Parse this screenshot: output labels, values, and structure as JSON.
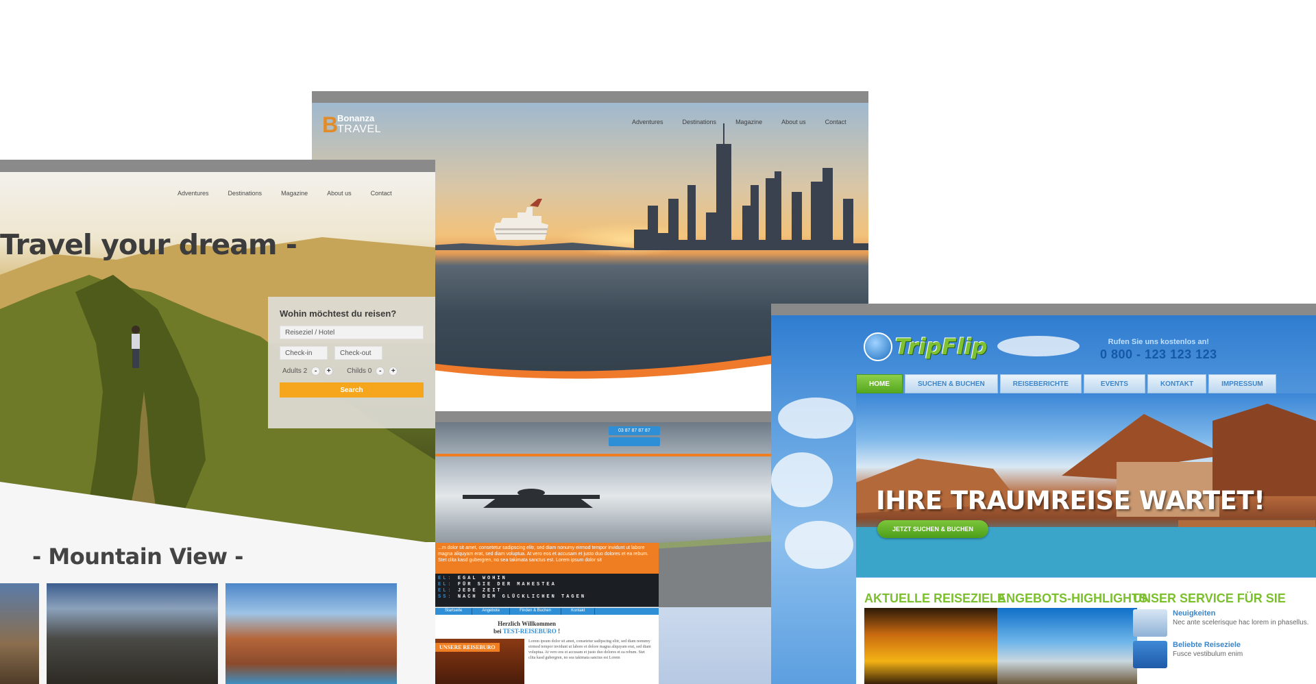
{
  "bonanza": {
    "logo_line1": "Bonanza",
    "logo_line2": "TRAVEL",
    "nav": [
      "Adventures",
      "Destinations",
      "Magazine",
      "About us",
      "Contact"
    ]
  },
  "travel": {
    "nav": [
      "Adventures",
      "Destinations",
      "Magazine",
      "About us",
      "Contact"
    ],
    "title": "Travel your dream -",
    "panel": {
      "heading": "Wohin möchtest du reisen?",
      "destination_placeholder": "Reiseziel / Hotel",
      "checkin": "Check-in",
      "checkout": "Check-out",
      "adults": "Adults 2",
      "childs": "Childs 0",
      "minus": "-",
      "plus": "+",
      "search": "Search"
    },
    "section_title": "- Mountain View -"
  },
  "reise": {
    "phone": "03 87 87 87 87",
    "orange_text": "...m dolor sit amet, consetetur sadipscing elitr, sed diam nonumy eirmod tempor invidunt ut labore magna aliquyam erat, sed diam voluptua. At vero eos et accusam et justo duo dolores et ea rebum. Stet clita kasd gubergren, no sea takimata sanctus est. Lorem ipsum dolor sit",
    "board": [
      {
        "key": "EL:",
        "text": "EGAL WOHIN"
      },
      {
        "key": "EL:",
        "text": "FÜR SIE DER MAHESTEA"
      },
      {
        "key": "EL:",
        "text": "JEDE ZEIT"
      },
      {
        "key": "SS:",
        "text": "NACH DEM GLÜCKLICHEN TAGEN"
      }
    ],
    "nav": [
      "Startseite",
      "Angebote",
      "Finden & Buchen",
      "Kontakt"
    ],
    "welcome_line1": "Herzlich Willkommen",
    "welcome_line2a": "bei",
    "welcome_line2b": "TEST-REISEBURO",
    "welcome_line2c": "!",
    "unsere": "UNSERE REISEBURO",
    "lorem": "Lorem ipsum dolor sit amet, consetetur sadipscing elitr, sed diam nonumy eirmod tempor invidunt ut labore et dolore magna aliquyam erat, sed diam voluptua. At vero eos et accusam et justo duo dolores et ea rebum. Stet clita kasd gubergren, no sea takimata sanctus est Lorem"
  },
  "tripflip": {
    "logo": "TripFlip",
    "call_label": "Rufen Sie uns kostenlos an!",
    "phone": "0 800 - 123 123 123",
    "tabs": [
      "HOME",
      "SUCHEN & BUCHEN",
      "REISEBERICHTE",
      "EVENTS",
      "KONTAKT",
      "IMPRESSUM"
    ],
    "headline": "IHRE TRAUMREISE WARTET!",
    "cta": "JETZT SUCHEN & BUCHEN",
    "sections": [
      "AKTUELLE REISEZIELE",
      "ANGEBOTS-HIGHLIGHTS",
      "UNSER SERVICE FÜR SIE"
    ],
    "service": [
      {
        "title": "Neuigkeiten",
        "text": "Nec ante scelerisque hac lorem in phasellus."
      },
      {
        "title": "Beliebte Reiseziele",
        "text": "Fusce vestibulum enim"
      }
    ]
  }
}
